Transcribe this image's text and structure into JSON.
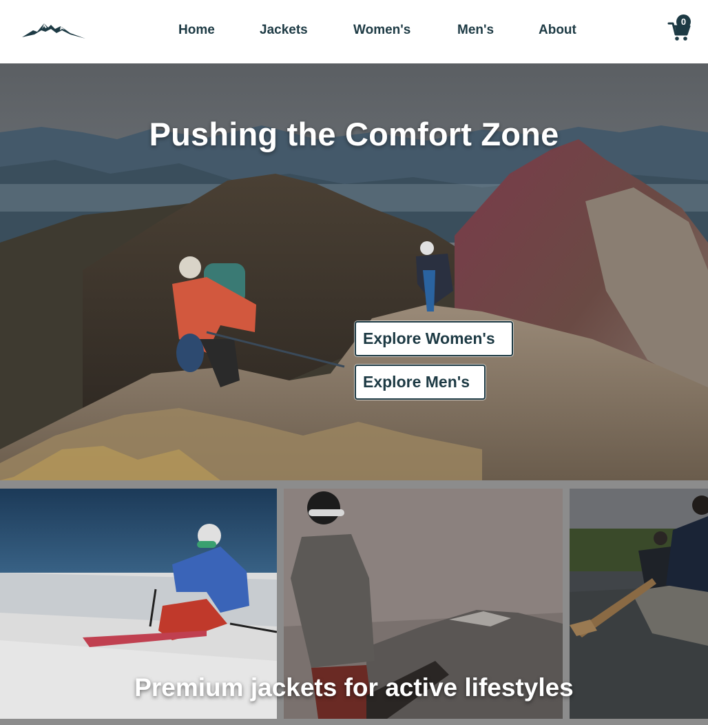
{
  "nav": {
    "items": [
      {
        "label": "Home"
      },
      {
        "label": "Jackets"
      },
      {
        "label": "Women's"
      },
      {
        "label": "Men's"
      },
      {
        "label": "About"
      }
    ]
  },
  "cart": {
    "count": "0",
    "icon": "shopping-cart-icon"
  },
  "logo": {
    "icon": "mountain-logo-icon"
  },
  "hero": {
    "title": "Pushing the Comfort Zone",
    "buttons": {
      "women": "Explore Women's",
      "men": "Explore Men's"
    }
  },
  "gallery": {
    "tagline": "Premium jackets for active lifestyles",
    "tiles": [
      "skier",
      "snowboarder",
      "canoe"
    ]
  },
  "colors": {
    "brand": "#1d3a44",
    "header_bg": "#ffffff",
    "gallery_bg": "#8c8c8c"
  }
}
